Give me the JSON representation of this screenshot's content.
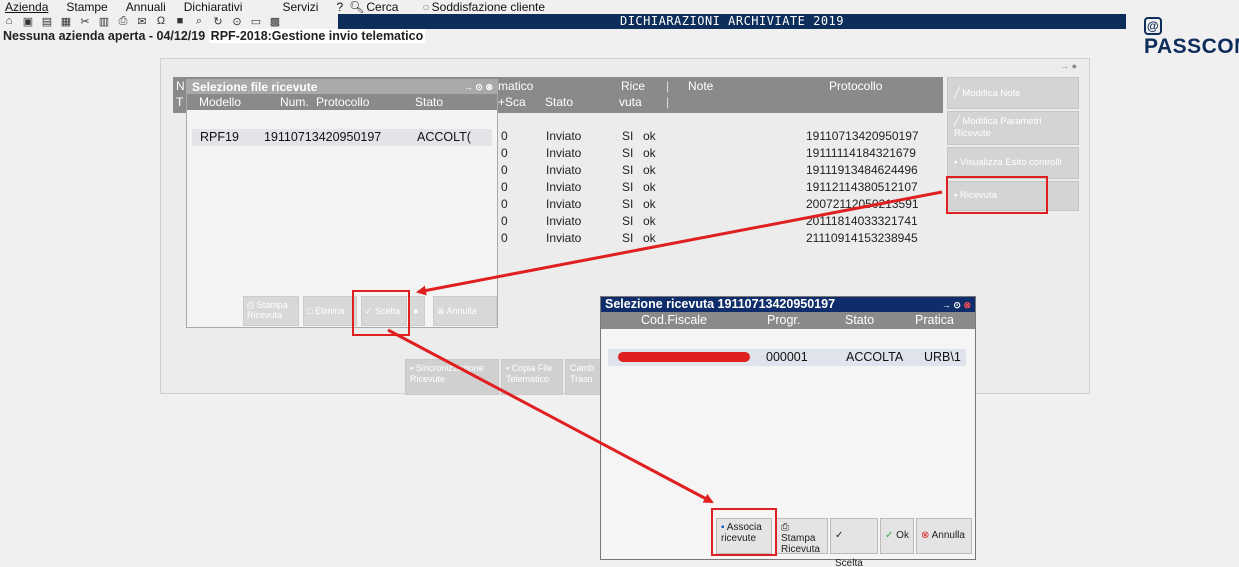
{
  "menu": {
    "azienda": "Azienda",
    "stampe": "Stampe",
    "annuali": "Annuali",
    "dichiarativi": "Dichiarativi",
    "servizi": "Servizi",
    "help": "?",
    "cerca": "Cerca",
    "soddisfazione": "Soddisfazione cliente"
  },
  "titlebar": {
    "title": "DICHIARAZIONI ARCHIVIATE 2019"
  },
  "logo": {
    "text": "PASSCOM"
  },
  "context": {
    "prefix": "Nessuna azienda aperta - 04/12/19",
    "highlight": "RPF-2018:Gestione invio telematico"
  },
  "main_table": {
    "headers": {
      "n": "N",
      "t": "T",
      "matico": "matico",
      "sca": "+Sca",
      "stato": "Stato",
      "rice": "Rice",
      "vuta": "vuta",
      "note": "Note",
      "protocollo": "Protocollo"
    },
    "rows": [
      {
        "sca": "0",
        "stato": "Inviato",
        "rice": "SI",
        "ok": "ok",
        "protocollo": "19110713420950197"
      },
      {
        "sca": "0",
        "stato": "Inviato",
        "rice": "SI",
        "ok": "ok",
        "protocollo": "19111114184321679"
      },
      {
        "sca": "0",
        "stato": "Inviato",
        "rice": "SI",
        "ok": "ok",
        "protocollo": "19111913484624496"
      },
      {
        "sca": "0",
        "stato": "Inviato",
        "rice": "SI",
        "ok": "ok",
        "protocollo": "19112114380512107"
      },
      {
        "sca": "0",
        "stato": "Inviato",
        "rice": "SI",
        "ok": "ok",
        "protocollo": "20072112050213591"
      },
      {
        "sca": "0",
        "stato": "Inviato",
        "rice": "SI",
        "ok": "ok",
        "protocollo": "20111814033321741"
      },
      {
        "sca": "0",
        "stato": "Inviato",
        "rice": "SI",
        "ok": "ok",
        "protocollo": "21110914153238945"
      }
    ]
  },
  "right_buttons": {
    "modifica_note": "Modifica Note",
    "modifica_parametri": "Modifica Parametri Ricevute",
    "visualizza_esito": "Visualizza Esito controlli",
    "ricevuta": "Ricevuta"
  },
  "bottom_buttons": {
    "sincronizzazione": "Sincronizzazione Ricevute",
    "copia_file": "Copia File Telematico",
    "cambia": "Camb Trasn"
  },
  "dialog1": {
    "title": "Selezione file ricevute",
    "headers": {
      "modello": "Modello",
      "num": "Num.",
      "protocollo": "Protocollo",
      "stato": "Stato"
    },
    "row": {
      "modello": "RPF19",
      "protocollo": "19110713420950197",
      "stato": "ACCOLT("
    },
    "buttons": {
      "stampa": "Stampa Ricevuta",
      "elimina": "Elimina",
      "scelta": "Scelta",
      "annulla": "Annulla"
    }
  },
  "dialog2": {
    "title": "Selezione ricevuta 19110713420950197",
    "headers": {
      "codfiscale": "Cod.Fiscale",
      "progr": "Progr.",
      "stato": "Stato",
      "pratica": "Pratica"
    },
    "row": {
      "progr": "000001",
      "stato": "ACCOLTA",
      "pratica": "URB\\1"
    },
    "buttons": {
      "associa": "Associa ricevute",
      "stampa": "Stampa Ricevuta",
      "scelta": "Scelta",
      "ok": "Ok",
      "annulla": "Annulla"
    }
  },
  "colors": {
    "title_bg": "#0d2d5a",
    "annotation": "#e02020",
    "header_gray": "#8a8a8a"
  }
}
